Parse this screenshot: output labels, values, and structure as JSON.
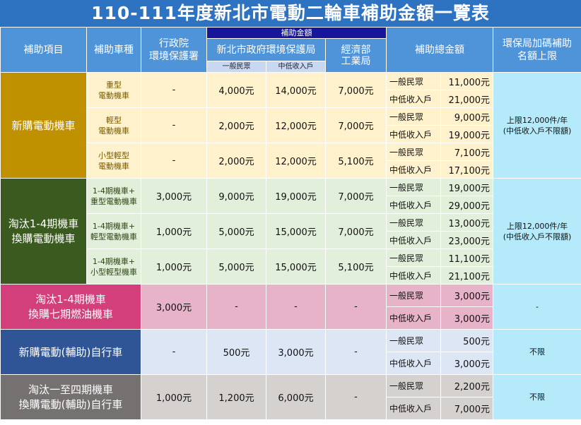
{
  "title": "110-111年度新北市電動二輪車補助金額一覽表",
  "headers": {
    "item": "補助項目",
    "vehicle": "補助車種",
    "epa": [
      "行政院",
      "環境保護署"
    ],
    "subsidy_amount": "補助金額",
    "ntpc": "新北市政府環境保護局",
    "ntpc_general": "一般民眾",
    "ntpc_low": "中低收入戶",
    "moea": [
      "經濟部",
      "工業局"
    ],
    "total": "補助總金額",
    "cap": [
      "環保局加碼補助",
      "名額上限"
    ]
  },
  "groups": [
    {
      "category": [
        "新購電動機車"
      ],
      "cap": [
        "上限12,000件/年",
        "(中低收入戶不限額)"
      ],
      "rows": [
        {
          "vehicle": [
            "重型",
            "電動機車"
          ],
          "epa": "-",
          "general": "4,000元",
          "low": "14,000元",
          "moea": "7,000元",
          "t_general": "11,000元",
          "t_low": "21,000元"
        },
        {
          "vehicle": [
            "輕型",
            "電動機車"
          ],
          "epa": "-",
          "general": "2,000元",
          "low": "12,000元",
          "moea": "7,000元",
          "t_general": "9,000元",
          "t_low": "19,000元"
        },
        {
          "vehicle": [
            "小型輕型",
            "電動機車"
          ],
          "epa": "-",
          "general": "2,000元",
          "low": "12,000元",
          "moea": "5,100元",
          "t_general": "7,100元",
          "t_low": "17,100元"
        }
      ]
    },
    {
      "category": [
        "淘汰1-4期機車",
        "換購電動機車"
      ],
      "cap": [
        "上限12,000件/年",
        "(中低收入戶不限額)"
      ],
      "rows": [
        {
          "vehicle": [
            "1-4期機車+",
            "重型電動機車"
          ],
          "epa": "3,000元",
          "general": "9,000元",
          "low": "19,000元",
          "moea": "7,000元",
          "t_general": "19,000元",
          "t_low": "29,000元"
        },
        {
          "vehicle": [
            "1-4期機車+",
            "輕型電動機車"
          ],
          "epa": "1,000元",
          "general": "5,000元",
          "low": "15,000元",
          "moea": "7,000元",
          "t_general": "13,000元",
          "t_low": "23,000元"
        },
        {
          "vehicle": [
            "1-4期機車+",
            "小型輕型機車"
          ],
          "epa": "1,000元",
          "general": "5,000元",
          "low": "15,000元",
          "moea": "5,100元",
          "t_general": "11,100元",
          "t_low": "21,100元"
        }
      ]
    },
    {
      "category": [
        "淘汰1-4期機車",
        "換購七期燃油機車"
      ],
      "epa": "3,000元",
      "general": "-",
      "low": "-",
      "moea": "-",
      "t_general": "3,000元",
      "t_low": "3,000元",
      "cap": "-"
    },
    {
      "category": [
        "新購電動(輔助)自行車"
      ],
      "epa": "-",
      "general": "500元",
      "low": "3,000元",
      "moea": "-",
      "t_general": "500元",
      "t_low": "3,000元",
      "cap": "不限"
    },
    {
      "category": [
        "淘汰一至四期機車",
        "換購電動(輔助)自行車"
      ],
      "epa": "1,000元",
      "general": "1,200元",
      "low": "6,000元",
      "moea": "-",
      "t_general": "2,200元",
      "t_low": "7,000元",
      "cap": "不限"
    }
  ],
  "labels": {
    "general": "一般民眾",
    "low": "中低收入戶"
  }
}
